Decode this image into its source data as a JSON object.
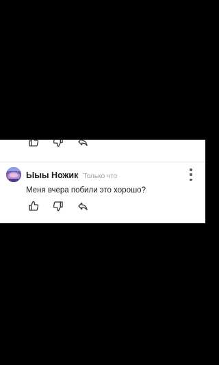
{
  "comment": {
    "author": "Ыыы Ножик",
    "timestamp": "Только что",
    "text": "Меня вчера побили это хорошо?"
  },
  "icons": {
    "like": "thumbs-up-icon",
    "dislike": "thumbs-down-icon",
    "reply": "reply-icon",
    "more": "more-vertical-icon"
  },
  "colors": {
    "background": "#000000",
    "panel": "#ffffff",
    "icon": "#333333",
    "author": "#1a1a1a",
    "timestamp": "#a0a0a0",
    "avatar": "#5b4fa0"
  }
}
